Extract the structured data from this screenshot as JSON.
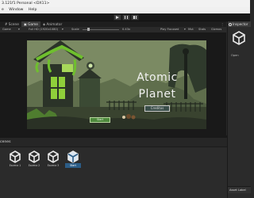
{
  "window": {
    "title": "3.121f1 Personal <DX11>"
  },
  "menu": {
    "items": [
      "e",
      "Window",
      "Help"
    ]
  },
  "tabs": {
    "scene": "Scene",
    "game": "Game",
    "animator": "Animator",
    "inspector": "Inspector"
  },
  "game_toolbar": {
    "display": "Game",
    "resolution": "Full HD (1920x1080)",
    "scale_label": "Scale",
    "scale_value": "0.43x",
    "play_mode": "Play Focused",
    "mute": "Mut",
    "stats": "Stats",
    "gizmos": "Gizmos"
  },
  "game": {
    "title_line1": "Atomic",
    "title_line2": "Planet",
    "credits_button": "Creditos",
    "start_button": "Start"
  },
  "project": {
    "panel_title": "cenes",
    "assets": [
      {
        "label": "Escena 1",
        "selected": false
      },
      {
        "label": "Escena 2",
        "selected": false
      },
      {
        "label": "Escena 3",
        "selected": false
      },
      {
        "label": "Start",
        "selected": true
      }
    ]
  },
  "inspector": {
    "open_button": "Open",
    "asset_labels": "Asset Label"
  },
  "colors": {
    "slime_green": "#6fbf2e",
    "window_green": "#8fcf3a",
    "scene_bg": "#6f7f55",
    "selection_blue": "#2c5d87"
  }
}
